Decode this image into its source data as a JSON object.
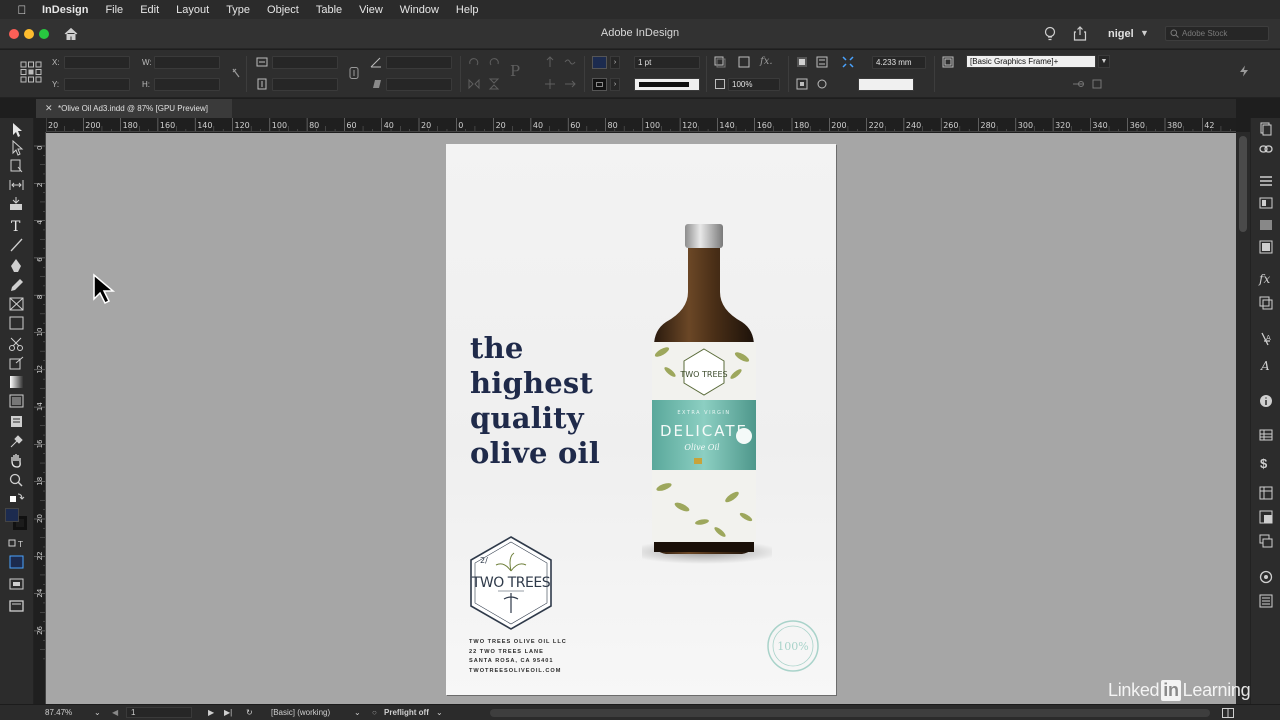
{
  "menubar": {
    "app_name": "InDesign",
    "items": [
      "File",
      "Edit",
      "Layout",
      "Type",
      "Object",
      "Table",
      "View",
      "Window",
      "Help"
    ]
  },
  "titlebar": {
    "title": "Adobe InDesign",
    "user": "nigel",
    "stock_placeholder": "Adobe Stock"
  },
  "control_panel": {
    "x_label": "X:",
    "y_label": "Y:",
    "w_label": "W:",
    "h_label": "H:",
    "stroke_weight": "1 pt",
    "opacity": "100%",
    "fitting_value": "4.233 mm",
    "object_style": "[Basic Graphics Frame]+",
    "fill_color": "#1c2b4f"
  },
  "document_tab": {
    "title": "*Olive Oil Ad3.indd @ 87% [GPU Preview]"
  },
  "ruler_h_labels": [
    "20",
    "200",
    "180",
    "160",
    "140",
    "120",
    "100",
    "80",
    "60",
    "40",
    "20",
    "0",
    "20",
    "40",
    "60",
    "80",
    "100",
    "120",
    "140",
    "160",
    "180",
    "200",
    "220",
    "240",
    "260",
    "280",
    "300",
    "320",
    "340",
    "360",
    "380",
    "42"
  ],
  "ruler_v_labels": [
    "0",
    "2",
    "4",
    "6",
    "8",
    "10",
    "12",
    "14",
    "16",
    "18",
    "20",
    "22",
    "24",
    "26"
  ],
  "ad": {
    "headline_lines": [
      "the",
      "highest",
      "quality",
      "olive oil"
    ],
    "bottle": {
      "brand": "TWO TREES",
      "subtitle": "EXTRA VIRGIN",
      "product": "DELICATE",
      "script": "Olive Oil"
    },
    "logo_text": "TWO TREES",
    "address_lines": [
      "TWO TREES OLIVE OIL LLC",
      "22 TWO TREES LANE",
      "SANTA ROSA, CA 95401",
      "TWOTREESOLIVEOIL.COM"
    ],
    "stamp_text": "100%"
  },
  "statusbar": {
    "zoom": "87.47%",
    "page": "1",
    "style": "[Basic] (working)",
    "preflight": "Preflight off"
  },
  "watermark": {
    "prefix": "Linked",
    "box": "in",
    "suffix": "Learning"
  }
}
